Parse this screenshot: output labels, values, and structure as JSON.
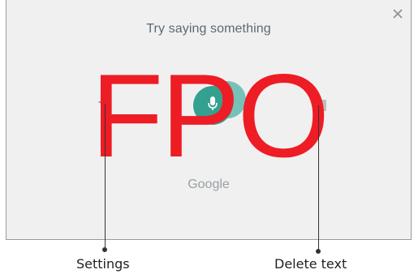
{
  "dialog": {
    "prompt": "Try saying something",
    "brand": "Google",
    "overlay_text": "FPO"
  },
  "icons": {
    "close": "close-icon",
    "settings": "settings-icon",
    "microphone": "microphone-icon",
    "delete": "delete-icon"
  },
  "callouts": {
    "settings": "Settings",
    "delete_text": "Delete text"
  },
  "colors": {
    "panel_bg": "#f0f0f0",
    "mic_accent": "#34a08f",
    "overlay": "#ee1c24"
  }
}
